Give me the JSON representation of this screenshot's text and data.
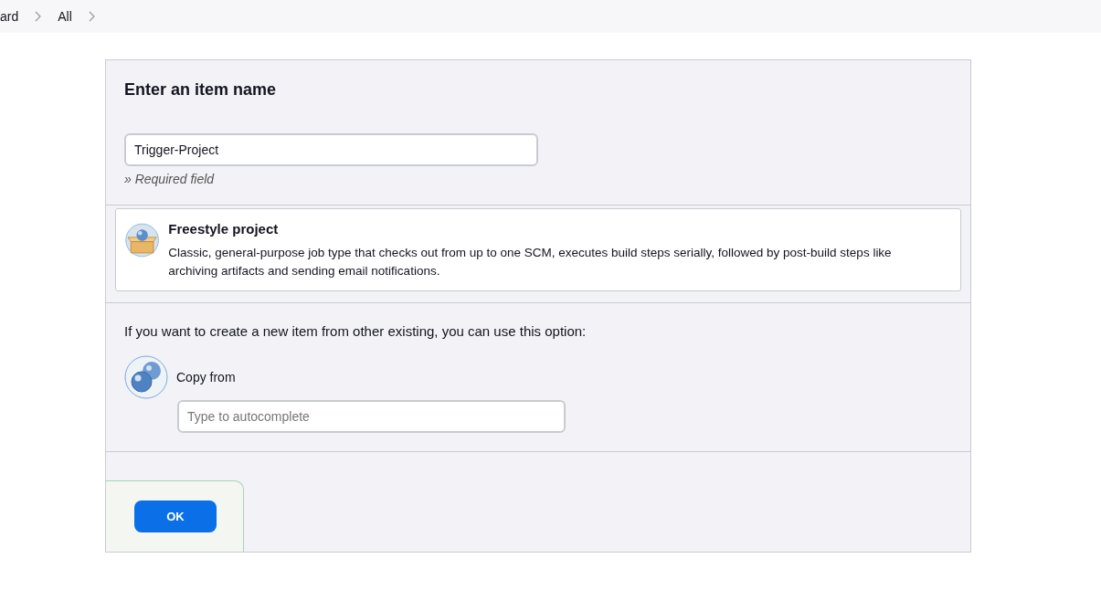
{
  "breadcrumbs": [
    {
      "label": "ard"
    },
    {
      "label": "All"
    }
  ],
  "name_section": {
    "title": "Enter an item name",
    "value": "Trigger-Project",
    "hint": "» Required field"
  },
  "item_types": [
    {
      "name": "Freestyle project",
      "description": "Classic, general-purpose job type that checks out from up to one SCM, executes build steps serially, followed by post-build steps like archiving artifacts and sending email notifications.",
      "selected": false
    }
  ],
  "copy_section": {
    "intro": "If you want to create a new item from other existing, you can use this option:",
    "label": "Copy from",
    "placeholder": "Type to autocomplete"
  },
  "buttons": [
    {
      "label": "OK"
    }
  ]
}
